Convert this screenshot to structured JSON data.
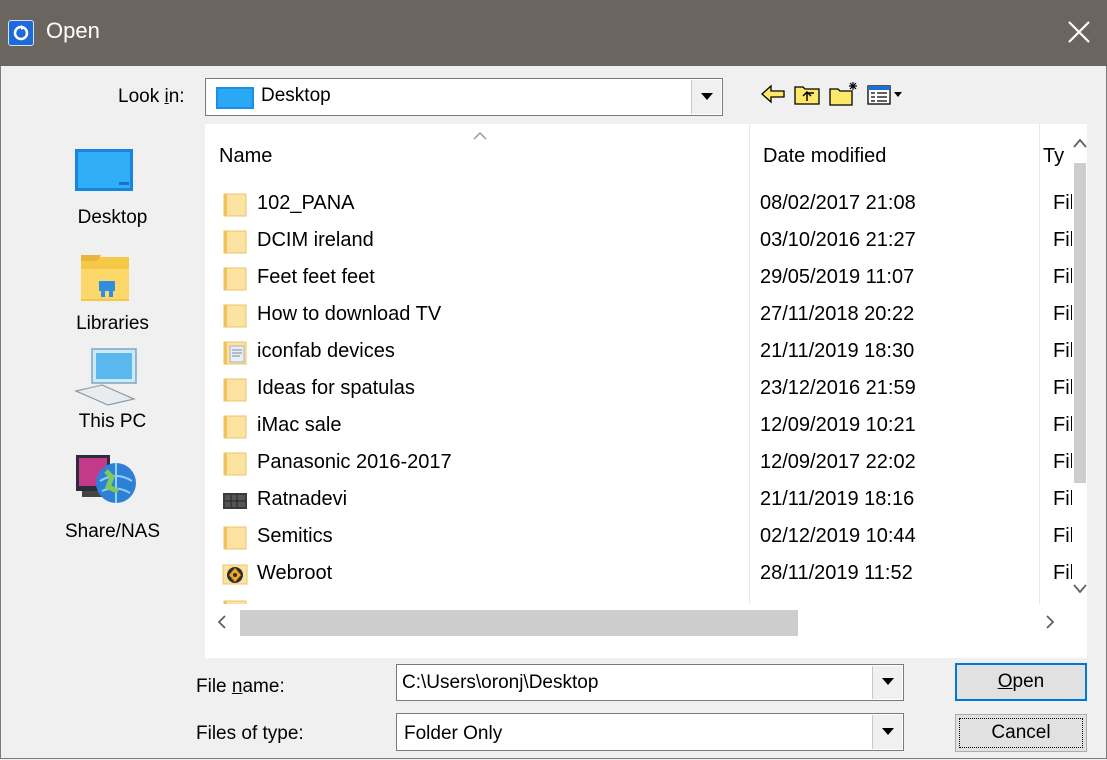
{
  "window": {
    "title": "Open",
    "close_glyph": "✕",
    "accent": "#0078d7"
  },
  "look_in": {
    "label": "Look in:",
    "value": "Desktop"
  },
  "toolbar": {
    "icons": [
      "back-arrow-icon",
      "up-folder-icon",
      "new-folder-icon",
      "view-menu-icon"
    ]
  },
  "places": [
    {
      "label": "Desktop",
      "icon": "desktop-icon"
    },
    {
      "label": "Libraries",
      "icon": "libraries-icon"
    },
    {
      "label": "This PC",
      "icon": "this-pc-icon"
    },
    {
      "label": "Share/NAS",
      "icon": "network-icon"
    }
  ],
  "columns": {
    "name": "Name",
    "date": "Date modified",
    "type": "Ty"
  },
  "files": [
    {
      "name": "102_PANA",
      "date": "08/02/2017 21:08",
      "type": "Fil",
      "icon": "folder"
    },
    {
      "name": "DCIM ireland",
      "date": "03/10/2016 21:27",
      "type": "Fil",
      "icon": "folder"
    },
    {
      "name": "Feet feet feet",
      "date": "29/05/2019 11:07",
      "type": "Fil",
      "icon": "folder"
    },
    {
      "name": "How to download TV",
      "date": "27/11/2018 20:22",
      "type": "Fil",
      "icon": "folder"
    },
    {
      "name": "iconfab devices",
      "date": "21/11/2019 18:30",
      "type": "Fil",
      "icon": "folder-docs"
    },
    {
      "name": "Ideas for spatulas",
      "date": "23/12/2016 21:59",
      "type": "Fil",
      "icon": "folder"
    },
    {
      "name": "iMac sale",
      "date": "12/09/2019 10:21",
      "type": "Fil",
      "icon": "folder"
    },
    {
      "name": "Panasonic 2016-2017",
      "date": "12/09/2017 22:02",
      "type": "Fil",
      "icon": "folder"
    },
    {
      "name": "Ratnadevi",
      "date": "21/11/2019 18:16",
      "type": "Fil",
      "icon": "folder-image"
    },
    {
      "name": "Semitics",
      "date": "02/12/2019 10:44",
      "type": "Fil",
      "icon": "folder"
    },
    {
      "name": "Webroot",
      "date": "28/11/2019 11:52",
      "type": "Fil",
      "icon": "folder-webroot"
    }
  ],
  "file_name": {
    "label_pre": "File ",
    "label_u": "n",
    "label_post": "ame:",
    "value": "C:\\Users\\oronj\\Desktop"
  },
  "file_type": {
    "label": "Files of type:",
    "value": "Folder Only"
  },
  "buttons": {
    "open_u": "O",
    "open_rest": "pen",
    "cancel": "Cancel"
  }
}
